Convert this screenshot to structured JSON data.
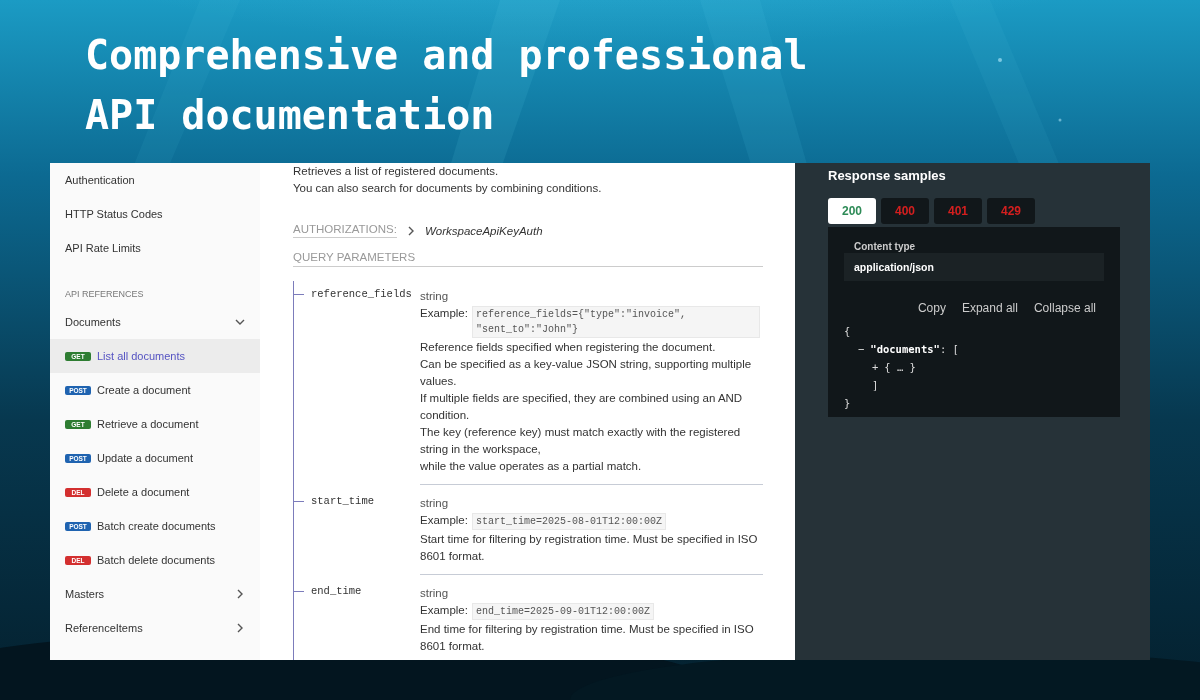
{
  "headline": {
    "lines": [
      "Comprehensive and professional",
      "API documentation"
    ]
  },
  "sidebar": {
    "items": [
      {
        "kind": "link",
        "label": "Authentication",
        "selected": false
      },
      {
        "kind": "link",
        "label": "HTTP Status Codes",
        "selected": false
      },
      {
        "kind": "link",
        "label": "API Rate Limits",
        "selected": false
      },
      {
        "kind": "section",
        "label": "API REFERENCES"
      },
      {
        "kind": "group",
        "label": "Documents",
        "expanded": true,
        "selected": false
      },
      {
        "kind": "endpoint",
        "method": "GET",
        "color": "#2e7d32",
        "label": "List all documents",
        "selected": true
      },
      {
        "kind": "endpoint",
        "method": "POST",
        "color": "#1f63b0",
        "label": "Create a document",
        "selected": false
      },
      {
        "kind": "endpoint",
        "method": "GET",
        "color": "#2e7d32",
        "label": "Retrieve a document",
        "selected": false
      },
      {
        "kind": "endpoint",
        "method": "POST",
        "color": "#1f63b0",
        "label": "Update a document",
        "selected": false
      },
      {
        "kind": "endpoint",
        "method": "DEL",
        "color": "#d32f2f",
        "label": "Delete a document",
        "selected": false
      },
      {
        "kind": "endpoint",
        "method": "POST",
        "color": "#1f63b0",
        "label": "Batch create documents",
        "selected": false
      },
      {
        "kind": "endpoint",
        "method": "DEL",
        "color": "#d32f2f",
        "label": "Batch delete documents",
        "selected": false
      },
      {
        "kind": "group",
        "label": "Masters",
        "expanded": false,
        "selected": false
      },
      {
        "kind": "group",
        "label": "ReferenceItems",
        "expanded": false,
        "selected": false
      }
    ]
  },
  "content": {
    "description": [
      "Retrieves a list of registered documents.",
      "You can also search for documents by combining conditions."
    ],
    "authorizations": {
      "label": "AUTHORIZATIONS:",
      "value": "WorkspaceApiKeyAuth"
    },
    "query_parameters": {
      "title": "QUERY PARAMETERS",
      "params": [
        {
          "name": "reference_fields",
          "type": "string",
          "example_label": "Example:",
          "example": "reference_fields={\"type\":\"invoice\", \"sent_to\":\"John\"}",
          "description": [
            "Reference fields specified when registering the document.",
            "Can be specified as a key-value JSON string, supporting multiple values.",
            "If multiple fields are specified, they are combined using an AND condition.",
            "The key (reference key) must match exactly with the registered string in the workspace,",
            "while the value operates as a partial match."
          ]
        },
        {
          "name": "start_time",
          "type": "string",
          "example_label": "Example:",
          "example": "start_time=2025-08-01T12:00:00Z",
          "description": [
            "Start time for filtering by registration time. Must be specified in ISO 8601 format."
          ]
        },
        {
          "name": "end_time",
          "type": "string",
          "example_label": "Example:",
          "example": "end_time=2025-09-01T12:00:00Z",
          "description": [
            "End time for filtering by registration time. Must be specified in ISO 8601 format."
          ]
        }
      ]
    }
  },
  "response_samples": {
    "title": "Response samples",
    "tabs": [
      {
        "label": "200",
        "color": "#2e8b57",
        "selected": true
      },
      {
        "label": "400",
        "color": "#d41f1f",
        "selected": false
      },
      {
        "label": "401",
        "color": "#d41f1f",
        "selected": false
      },
      {
        "label": "429",
        "color": "#d41f1f",
        "selected": false
      }
    ],
    "content_type": {
      "label": "Content type",
      "value": "application/json"
    },
    "actions": [
      "Copy",
      "Expand all",
      "Collapse all"
    ],
    "code": {
      "text": "{",
      "close": "}",
      "children": [
        {
          "toggle": "−",
          "key": "\"documents\"",
          "text": ": [",
          "close": "]",
          "children": [
            {
              "toggle": "+",
              "text": "{ … }"
            }
          ]
        }
      ]
    }
  }
}
